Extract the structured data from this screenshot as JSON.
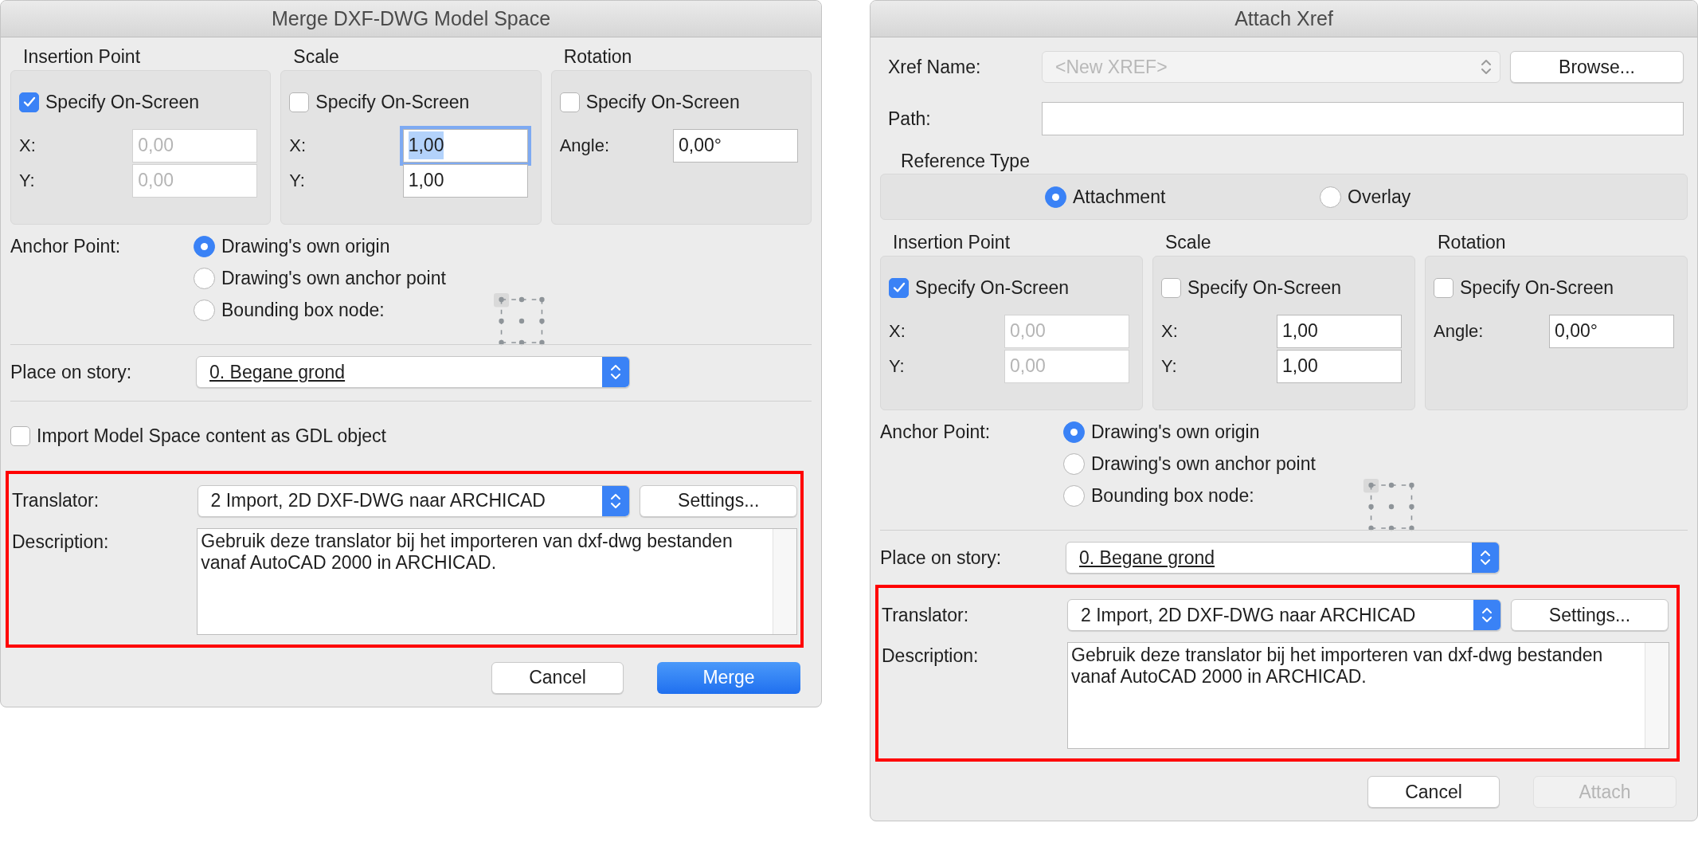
{
  "dialogs": [
    {
      "title": "Merge DXF-DWG Model Space",
      "groups": [
        {
          "label": "Insertion Point",
          "checkbox": {
            "label": "Specify On-Screen",
            "checked": true
          },
          "fields": [
            {
              "label": "X:",
              "value": "0,00",
              "disabled": true,
              "focused": false
            },
            {
              "label": "Y:",
              "value": "0,00",
              "disabled": true,
              "focused": false
            }
          ]
        },
        {
          "label": "Scale",
          "checkbox": {
            "label": "Specify On-Screen",
            "checked": false
          },
          "fields": [
            {
              "label": "X:",
              "value": "1,00",
              "disabled": false,
              "focused": true
            },
            {
              "label": "Y:",
              "value": "1,00",
              "disabled": false,
              "focused": false
            }
          ]
        },
        {
          "label": "Rotation",
          "checkbox": {
            "label": "Specify On-Screen",
            "checked": false
          },
          "fields": [
            {
              "label": "Angle:",
              "value": "0,00°",
              "disabled": false,
              "focused": false
            }
          ]
        }
      ],
      "anchor": {
        "label": "Anchor Point:",
        "options": [
          {
            "label": "Drawing's own origin",
            "selected": true
          },
          {
            "label": "Drawing's own anchor point",
            "selected": false
          },
          {
            "label": "Bounding box node:",
            "selected": false
          }
        ]
      },
      "story": {
        "label": "Place on story:",
        "value": "0. Begane grond"
      },
      "gdl_option": {
        "label": "Import Model Space content as GDL object",
        "checked": false
      },
      "translator": {
        "highlighted": true,
        "label": "Translator:",
        "value": "2 Import, 2D DXF-DWG naar ARCHICAD",
        "settings_button": "Settings...",
        "description_label": "Description:",
        "description": "Gebruik deze translator bij het importeren van dxf-dwg bestanden vanaf AutoCAD 2000 in ARCHICAD."
      },
      "buttons": [
        {
          "label": "Cancel",
          "kind": "default",
          "disabled": false
        },
        {
          "label": "Merge",
          "kind": "primary",
          "disabled": false
        }
      ]
    },
    {
      "title": "Attach Xref",
      "xref_name": {
        "label": "Xref Name:",
        "value": "<New XREF>",
        "disabled": true,
        "browse_button": "Browse..."
      },
      "path": {
        "label": "Path:"
      },
      "reference_type": {
        "label": "Reference Type",
        "options": [
          {
            "label": "Attachment",
            "selected": true
          },
          {
            "label": "Overlay",
            "selected": false
          }
        ]
      },
      "groups": [
        {
          "label": "Insertion Point",
          "checkbox": {
            "label": "Specify On-Screen",
            "checked": true
          },
          "fields": [
            {
              "label": "X:",
              "value": "0,00",
              "disabled": true,
              "focused": false
            },
            {
              "label": "Y:",
              "value": "0,00",
              "disabled": true,
              "focused": false
            }
          ]
        },
        {
          "label": "Scale",
          "checkbox": {
            "label": "Specify On-Screen",
            "checked": false
          },
          "fields": [
            {
              "label": "X:",
              "value": "1,00",
              "disabled": false,
              "focused": false
            },
            {
              "label": "Y:",
              "value": "1,00",
              "disabled": false,
              "focused": false
            }
          ]
        },
        {
          "label": "Rotation",
          "checkbox": {
            "label": "Specify On-Screen",
            "checked": false
          },
          "fields": [
            {
              "label": "Angle:",
              "value": "0,00°",
              "disabled": false,
              "focused": false
            }
          ]
        }
      ],
      "anchor": {
        "label": "Anchor Point:",
        "options": [
          {
            "label": "Drawing's own origin",
            "selected": true
          },
          {
            "label": "Drawing's own anchor point",
            "selected": false
          },
          {
            "label": "Bounding box node:",
            "selected": false
          }
        ]
      },
      "story": {
        "label": "Place on story:",
        "value": "0. Begane grond"
      },
      "translator": {
        "highlighted": true,
        "label": "Translator:",
        "value": "2 Import, 2D DXF-DWG naar ARCHICAD",
        "settings_button": "Settings...",
        "description_label": "Description:",
        "description": "Gebruik deze translator bij het importeren van dxf-dwg bestanden vanaf AutoCAD 2000 in ARCHICAD."
      },
      "buttons": [
        {
          "label": "Cancel",
          "kind": "default",
          "disabled": false
        },
        {
          "label": "Attach",
          "kind": "primary",
          "disabled": true
        }
      ]
    }
  ]
}
